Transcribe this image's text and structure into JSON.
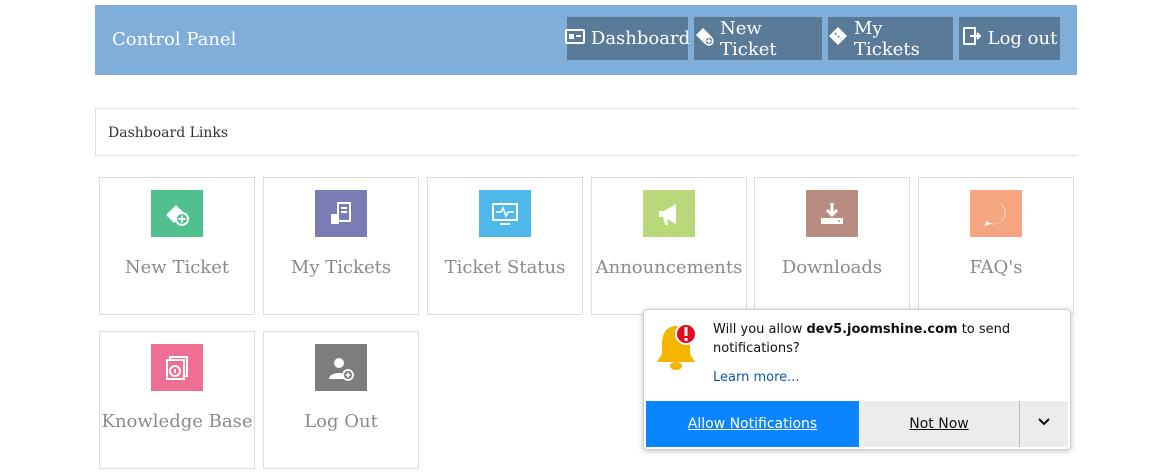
{
  "header": {
    "title": "Control Panel",
    "nav": [
      {
        "label": "Dashboard",
        "icon": "dashboard-icon"
      },
      {
        "label": "New Ticket",
        "icon": "new-ticket-icon"
      },
      {
        "label": "My Tickets",
        "icon": "ticket-icon"
      },
      {
        "label": "Log out",
        "icon": "logout-icon"
      }
    ],
    "bg_color": "#7fafd9",
    "button_color": "#5a7a9a"
  },
  "section": {
    "title": "Dashboard Links"
  },
  "tiles": [
    {
      "label": "New Ticket",
      "icon": "new-ticket-icon",
      "color": "#4fc08d"
    },
    {
      "label": "My Tickets",
      "icon": "my-tickets-icon",
      "color": "#7b7bb5"
    },
    {
      "label": "Ticket Status",
      "icon": "monitor-icon",
      "color": "#4fb8ea"
    },
    {
      "label": "Announcements",
      "icon": "megaphone-icon",
      "color": "#b8d97a"
    },
    {
      "label": "Downloads",
      "icon": "download-icon",
      "color": "#b98c80"
    },
    {
      "label": "FAQ's",
      "icon": "question-icon",
      "color": "#f5a580"
    },
    {
      "label": "Knowledge Base",
      "icon": "knowledge-base-icon",
      "color": "#ee6f93"
    },
    {
      "label": "Log Out",
      "icon": "user-logout-icon",
      "color": "#7d7d7d"
    }
  ],
  "notification": {
    "prefix": "Will you allow ",
    "domain": "dev5.joomshine.com",
    "suffix": " to send notifications?",
    "learn_more": "Learn more...",
    "allow_label": "Allow Notifications",
    "not_now_label": "Not Now",
    "allow_color": "#0a84ff"
  }
}
